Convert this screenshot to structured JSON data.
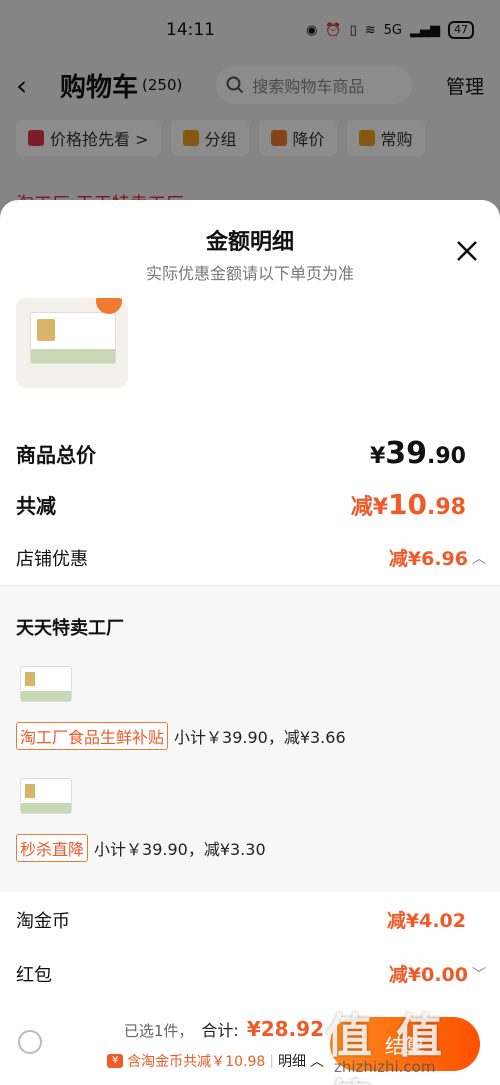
{
  "status_bar": {
    "time": "14:11",
    "battery": "47",
    "network": "5G"
  },
  "cart_header": {
    "title": "购物车",
    "count": "(250)",
    "search_placeholder": "搜索购物车商品",
    "manage_label": "管理"
  },
  "chips": [
    {
      "label": "价格抢先看 >",
      "icon": "price-tag-icon"
    },
    {
      "label": "分组",
      "icon": "folder-icon"
    },
    {
      "label": "降价",
      "icon": "price-drop-icon"
    },
    {
      "label": "常购",
      "icon": "cart-icon"
    }
  ],
  "background_shop_row": "淘工厂 天天特卖工厂",
  "sheet": {
    "title": "金额明细",
    "subtitle": "实际优惠金额请以下单页为准",
    "close_icon": "close-icon"
  },
  "summary": {
    "total_label": "商品总价",
    "total_yen": "¥",
    "total_int": "39",
    "total_cents": ".90",
    "reduce_label": "共减",
    "reduce_prefix": "减¥",
    "reduce_int": "10",
    "reduce_cents": ".98",
    "store_label": "店铺优惠",
    "store_value": "减¥6.96"
  },
  "shop": {
    "name": "天天特卖工厂",
    "promos": [
      {
        "tag": "淘工厂食品生鲜补贴",
        "detail": "小计￥39.90，减¥3.66"
      },
      {
        "tag": "秒杀直降",
        "detail": "小计￥39.90，减¥3.30"
      }
    ]
  },
  "extras": {
    "coins_label": "淘金币",
    "coins_value": "减¥4.02",
    "redpacket_label": "红包",
    "redpacket_value": "减¥0.00"
  },
  "footer": {
    "selected": "已选1件，",
    "total_label": "合计:",
    "total_value": "¥28.92",
    "coin_note": "含淘金币共减￥10.98",
    "detail_label": "明细",
    "checkout_label": "结算"
  },
  "watermark": {
    "big": "值 值 值",
    "small": "zhizhizhi.com"
  },
  "colors": {
    "accent": "#f05a28",
    "button_start": "#ff8a1f",
    "button_end": "#ff5000"
  }
}
